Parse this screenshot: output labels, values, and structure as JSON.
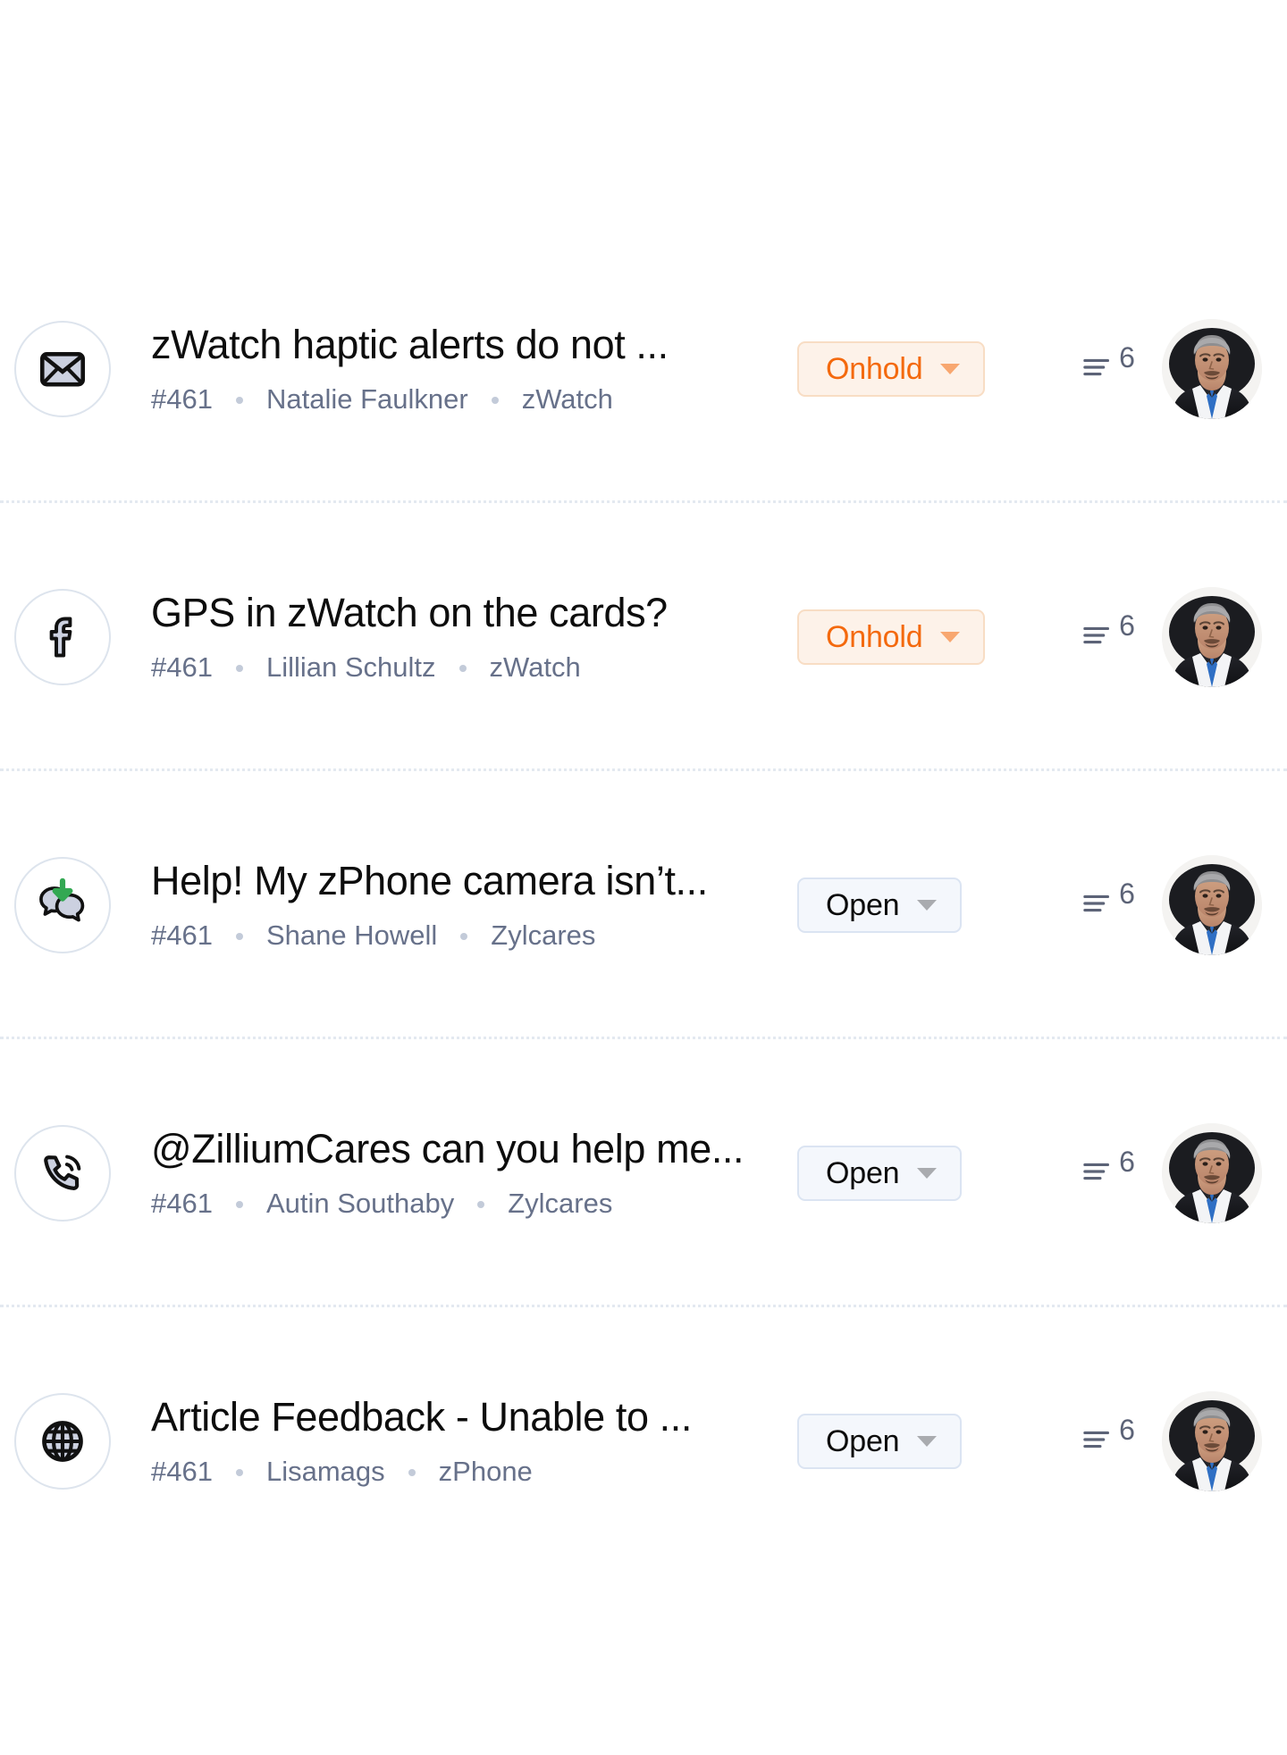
{
  "list": {
    "name": "ticket-list",
    "separator_color": "#e3e9f0"
  },
  "status_colors": {
    "onhold_text": "#f4690d",
    "onhold_bg": "#fdf2e9",
    "onhold_border": "#f8ddc4",
    "open_text": "#0b0b0b",
    "open_bg": "#f4f7fc",
    "open_border": "#dbe4f2"
  },
  "tickets": [
    {
      "channel_icon": "email-icon",
      "title": "zWatch haptic alerts do not ...",
      "id": "#461",
      "requester": "Natalie Faulkner",
      "product": "zWatch",
      "status": "Onhold",
      "status_kind": "onhold",
      "thread_count": "6",
      "avatar": "agent-avatar"
    },
    {
      "channel_icon": "facebook-icon",
      "title": "GPS in zWatch on the cards?",
      "id": "#461",
      "requester": "Lillian Schultz",
      "product": "zWatch",
      "status": "Onhold",
      "status_kind": "onhold",
      "thread_count": "6",
      "avatar": "agent-avatar"
    },
    {
      "channel_icon": "chat-icon",
      "title": "Help! My zPhone camera isn’t...",
      "id": "#461",
      "requester": "Shane Howell",
      "product": "Zylcares",
      "status": "Open",
      "status_kind": "open",
      "thread_count": "6",
      "avatar": "agent-avatar"
    },
    {
      "channel_icon": "phone-icon",
      "title": "@ZilliumCares can you help me...",
      "id": "#461",
      "requester": "Autin Southaby",
      "product": "Zylcares",
      "status": "Open",
      "status_kind": "open",
      "thread_count": "6",
      "avatar": "agent-avatar"
    },
    {
      "channel_icon": "globe-icon",
      "title": "Article Feedback - Unable to ...",
      "id": "#461",
      "requester": "Lisamags",
      "product": "zPhone",
      "status": "Open",
      "status_kind": "open",
      "thread_count": "6",
      "avatar": "agent-avatar"
    }
  ]
}
